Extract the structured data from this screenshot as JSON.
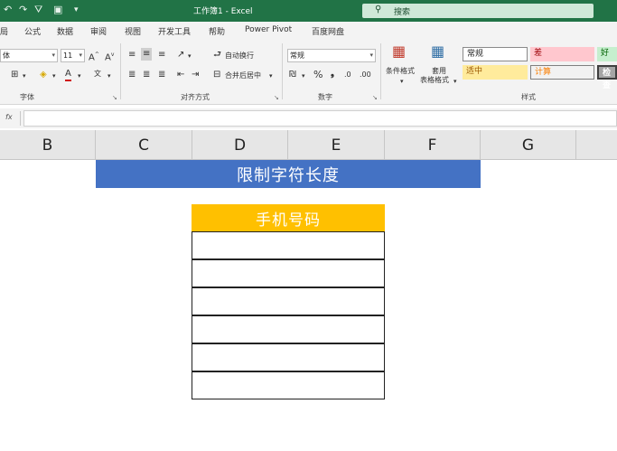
{
  "titlebar": {
    "title": "工作簿1  -  Excel",
    "search_label": "搜索"
  },
  "tabs": [
    "局",
    "公式",
    "数据",
    "审阅",
    "视图",
    "开发工具",
    "帮助",
    "Power Pivot",
    "百度网盘"
  ],
  "font_group": {
    "font_name": "体",
    "font_size": "11",
    "label": "字体"
  },
  "alignment_group": {
    "wrap_text": "自动换行",
    "merge_center": "合并后居中",
    "label": "对齐方式"
  },
  "number_group": {
    "format": "常规",
    "label": "数字"
  },
  "styles_group": {
    "conditional_format": "条件格式",
    "table_format_line1": "套用",
    "table_format_line2": "表格格式",
    "normal": "常规",
    "bad": "差",
    "good": "好",
    "neutral": "适中",
    "calculation": "计算",
    "check": "检查",
    "label": "样式"
  },
  "formula_bar": {
    "fx": "fx",
    "value": ""
  },
  "columns": [
    "B",
    "C",
    "D",
    "E",
    "F",
    "G"
  ],
  "sheet": {
    "banner": "限制字符长度",
    "phone_header": "手机号码",
    "phone_cells": [
      "",
      "",
      "",
      "",
      "",
      ""
    ]
  },
  "colors": {
    "excel_green": "#217346",
    "banner_blue": "#4472c4",
    "header_gold": "#ffc000"
  }
}
